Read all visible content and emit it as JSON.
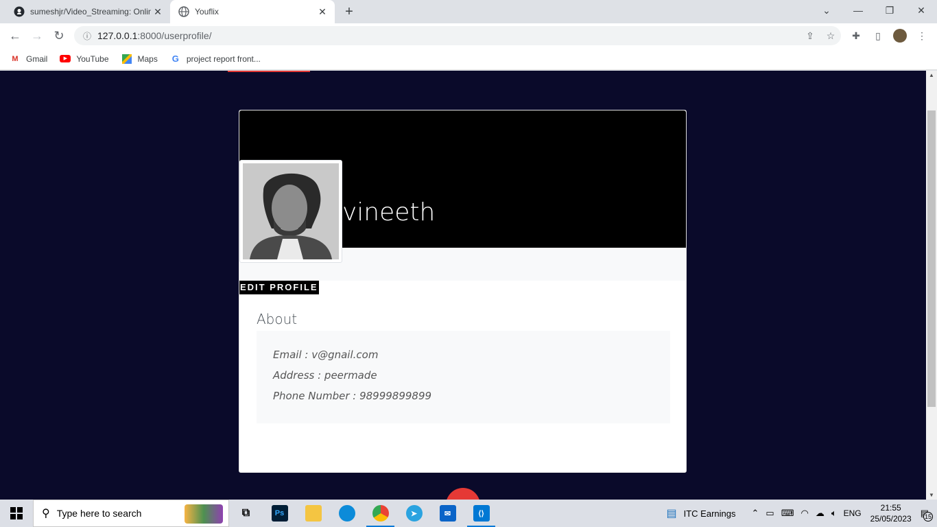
{
  "browser": {
    "tabs": [
      {
        "title": "sumeshjr/Video_Streaming: Onlin",
        "icon": "github-icon"
      },
      {
        "title": "Youflix",
        "icon": "globe-icon"
      }
    ],
    "url_host": "127.0.0.1",
    "url_rest": ":8000/userprofile/",
    "bookmarks": [
      {
        "label": "Gmail",
        "icon": "gmail-icon",
        "color": "#d93025"
      },
      {
        "label": "YouTube",
        "icon": "youtube-icon",
        "color": "#ff0000"
      },
      {
        "label": "Maps",
        "icon": "maps-icon",
        "color": "#34a853"
      },
      {
        "label": "project report front...",
        "icon": "google-icon",
        "color": "#4285f4"
      }
    ]
  },
  "profile": {
    "username": "vineeth",
    "edit_label": "EDIT PROFILE",
    "about_title": "About",
    "email": "Email : v@gnail.com",
    "address": "Address : peermade",
    "phone": "Phone Number : 98999899899"
  },
  "taskbar": {
    "search_placeholder": "Type here to search",
    "widget_label": "ITC  Earnings",
    "language": "ENG",
    "time": "21:55",
    "date": "25/05/2023",
    "notifications": "15"
  }
}
